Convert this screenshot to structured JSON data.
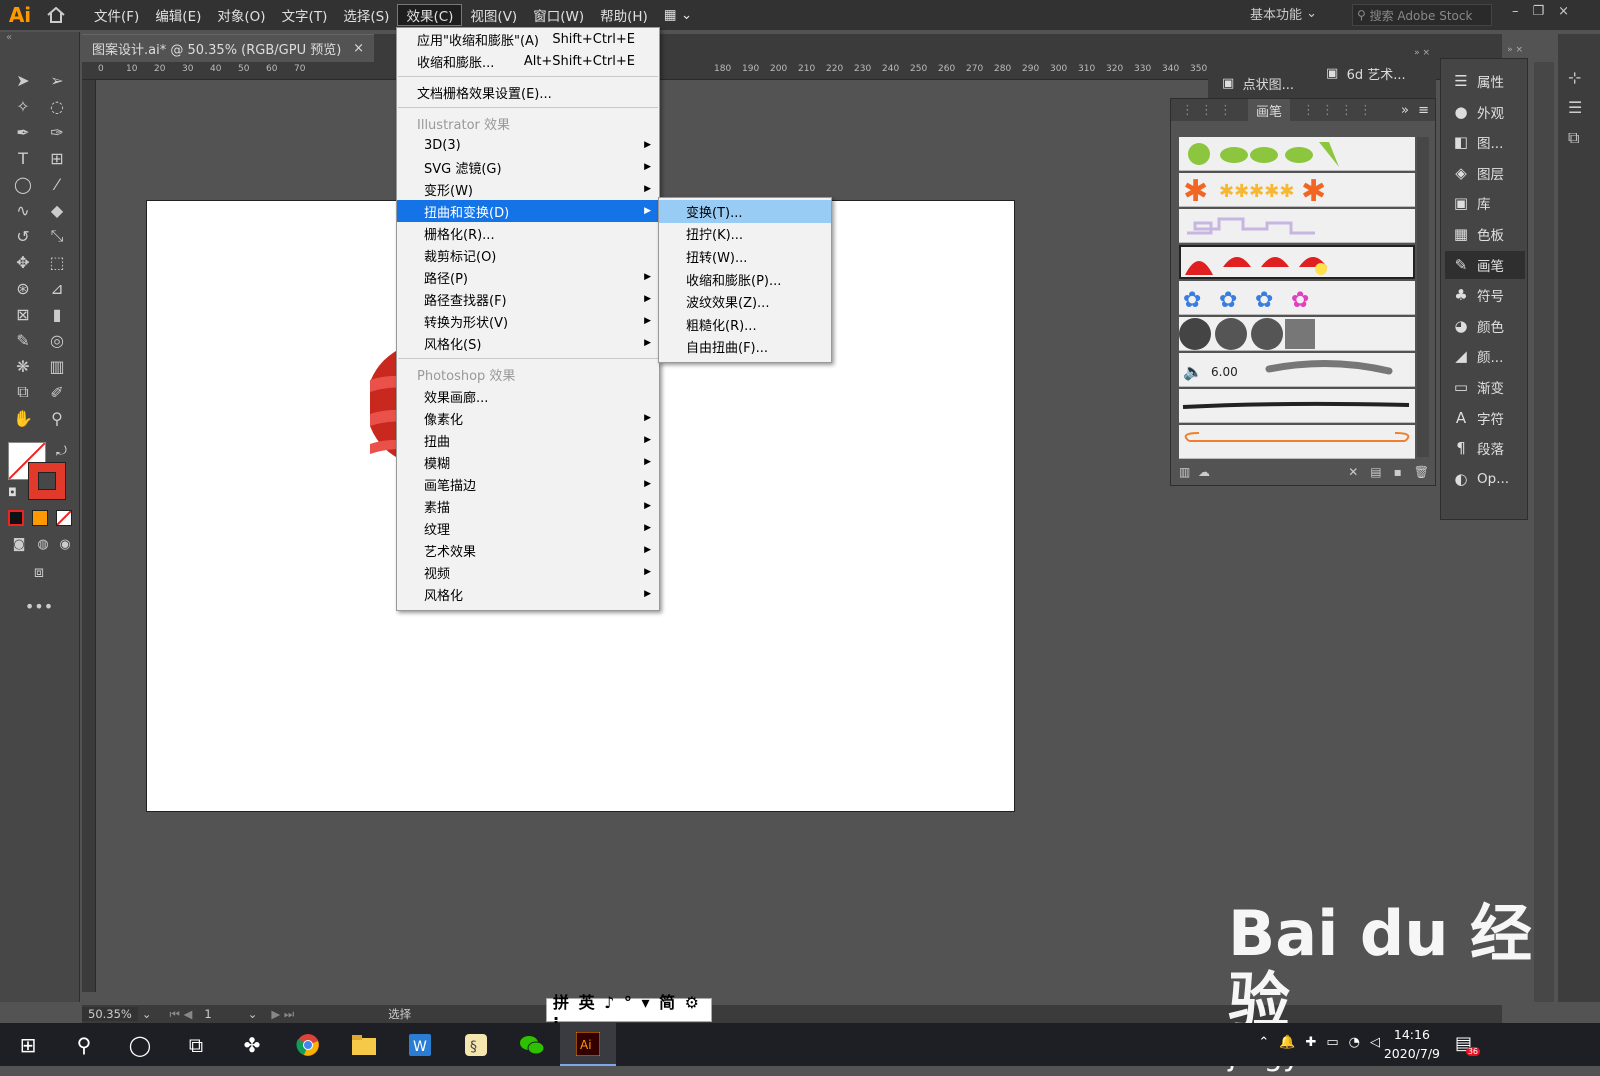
{
  "app": {
    "logo": "Ai"
  },
  "menubar": {
    "items": [
      "文件(F)",
      "编辑(E)",
      "对象(O)",
      "文字(T)",
      "选择(S)",
      "效果(C)",
      "视图(V)",
      "窗口(W)",
      "帮助(H)"
    ],
    "active_index": 5,
    "workspace": "基本功能",
    "search_placeholder": "搜索 Adobe Stock"
  },
  "document": {
    "tab_title": "图案设计.ai* @ 50.35% (RGB/GPU 预览)",
    "close": "×"
  },
  "ruler": {
    "h_ticks": [
      "0",
      "10",
      "20",
      "30",
      "40",
      "50",
      "60",
      "70",
      "",
      "",
      "",
      "",
      "",
      "",
      "",
      "",
      "",
      "",
      "",
      "",
      "",
      "",
      "180",
      "190",
      "200",
      "210",
      "220",
      "230",
      "240",
      "250",
      "260",
      "270",
      "280",
      "290",
      "300",
      "310",
      "320",
      "330",
      "340",
      "350"
    ]
  },
  "effect_menu": {
    "apply_last": {
      "label": "应用\"收缩和膨胀\"(A)",
      "shortcut": "Shift+Ctrl+E"
    },
    "last": {
      "label": "收缩和膨胀...",
      "shortcut": "Alt+Shift+Ctrl+E"
    },
    "raster": "文档栅格效果设置(E)...",
    "illustrator_section": "Illustrator 效果",
    "illustrator_items": [
      {
        "label": "3D(3)",
        "sub": true
      },
      {
        "label": "SVG 滤镜(G)",
        "sub": true
      },
      {
        "label": "变形(W)",
        "sub": true
      },
      {
        "label": "扭曲和变换(D)",
        "sub": true,
        "highlight": true
      },
      {
        "label": "栅格化(R)...",
        "sub": false
      },
      {
        "label": "裁剪标记(O)",
        "sub": false
      },
      {
        "label": "路径(P)",
        "sub": true
      },
      {
        "label": "路径查找器(F)",
        "sub": true
      },
      {
        "label": "转换为形状(V)",
        "sub": true
      },
      {
        "label": "风格化(S)",
        "sub": true
      }
    ],
    "photoshop_section": "Photoshop 效果",
    "photoshop_items": [
      {
        "label": "效果画廊...",
        "sub": false
      },
      {
        "label": "像素化",
        "sub": true
      },
      {
        "label": "扭曲",
        "sub": true
      },
      {
        "label": "模糊",
        "sub": true
      },
      {
        "label": "画笔描边",
        "sub": true
      },
      {
        "label": "素描",
        "sub": true
      },
      {
        "label": "纹理",
        "sub": true
      },
      {
        "label": "艺术效果",
        "sub": true
      },
      {
        "label": "视频",
        "sub": true
      },
      {
        "label": "风格化",
        "sub": true
      }
    ]
  },
  "distort_submenu": {
    "items": [
      "变换(T)...",
      "扭拧(K)...",
      "扭转(W)...",
      "收缩和膨胀(P)...",
      "波纹效果(Z)...",
      "粗糙化(R)...",
      "自由扭曲(F)..."
    ],
    "highlight_index": 0
  },
  "float_tabs": {
    "dots": "点状图...",
    "art": "6d 艺术..."
  },
  "brush_panel": {
    "title": "画笔",
    "size_value": "6.00"
  },
  "dock": {
    "items": [
      {
        "label": "属性",
        "icon": "properties-icon",
        "glyph": "☰"
      },
      {
        "label": "外观",
        "icon": "appearance-icon",
        "glyph": "●"
      },
      {
        "label": "图...",
        "icon": "graphic-styles-icon",
        "glyph": "◧"
      },
      {
        "label": "图层",
        "icon": "layers-icon",
        "glyph": "◈"
      },
      {
        "label": "库",
        "icon": "libraries-icon",
        "glyph": "▣"
      },
      {
        "label": "色板",
        "icon": "swatches-icon",
        "glyph": "▦"
      },
      {
        "label": "画笔",
        "icon": "brush-icon",
        "glyph": "✎",
        "active": true
      },
      {
        "label": "符号",
        "icon": "symbols-icon",
        "glyph": "♣"
      },
      {
        "label": "颜色",
        "icon": "color-icon",
        "glyph": "◕"
      },
      {
        "label": "颜...",
        "icon": "color-guide-icon",
        "glyph": "◢"
      },
      {
        "label": "渐变",
        "icon": "gradient-icon",
        "glyph": "▭"
      },
      {
        "label": "字符",
        "icon": "character-icon",
        "glyph": "A"
      },
      {
        "label": "段落",
        "icon": "paragraph-icon",
        "glyph": "¶"
      },
      {
        "label": "Op...",
        "icon": "opacity-icon",
        "glyph": "◐"
      }
    ]
  },
  "status": {
    "zoom": "50.35%",
    "page": "1",
    "tool": "选择"
  },
  "ime": {
    "text": "拼 英 ♪ ° ▾ 简 ⚙ ⁝"
  },
  "taskbar": {
    "time": "14:16",
    "date": "2020/7/9",
    "notif": "36"
  },
  "watermark": {
    "brand": "Bai du 经验",
    "url": "jingyan.baidu.com"
  }
}
